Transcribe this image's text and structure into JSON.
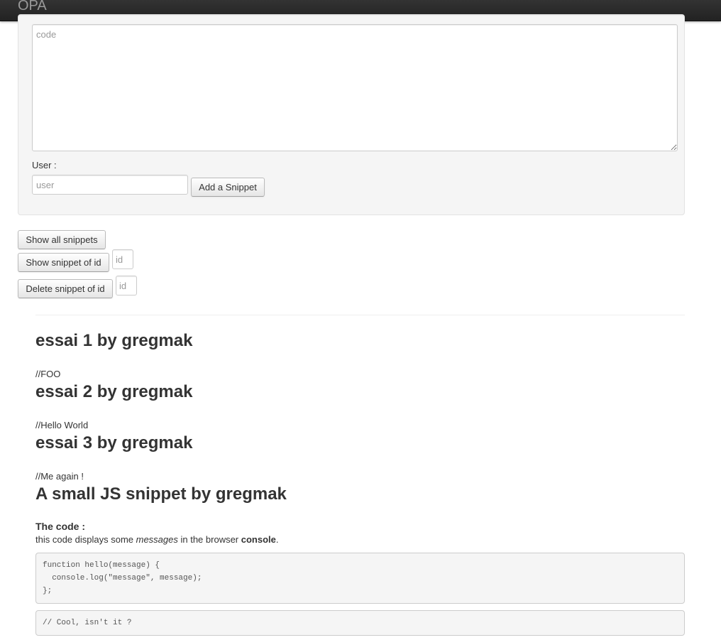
{
  "navbar": {
    "brand": "OPA"
  },
  "form": {
    "code_placeholder": "code",
    "code_value": "",
    "user_label": "User :",
    "user_placeholder": "user",
    "user_value": "",
    "add_button": "Add a Snippet"
  },
  "actions": {
    "show_all": "Show all snippets",
    "show_by_id": "Show snippet of id",
    "show_id_placeholder": "id",
    "delete_by_id": "Delete snippet of id",
    "delete_id_placeholder": "id"
  },
  "snippets": [
    {
      "title": "essai 1 by gregmak",
      "code": "//FOO"
    },
    {
      "title": "essai 2 by gregmak",
      "code": "//Hello World"
    },
    {
      "title": "essai 3 by gregmak",
      "code": "//Me again !"
    },
    {
      "title": "A small JS snippet by gregmak"
    }
  ],
  "last_snippet": {
    "heading": "The code :",
    "desc_prefix": "this code displays some ",
    "desc_em": "messages",
    "desc_mid": " in the browser ",
    "desc_strong": "console",
    "desc_suffix": ".",
    "code_block": "function hello(message) {\n  console.log(\"message\", message);\n};",
    "comment_block": "// Cool, isn't it ?"
  }
}
